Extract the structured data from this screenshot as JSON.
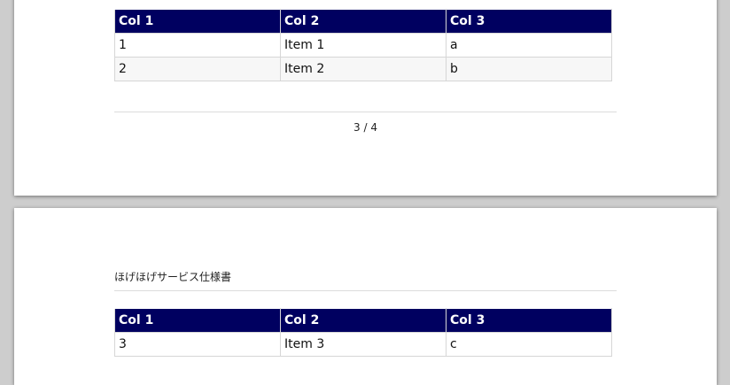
{
  "document": {
    "header_title": "ほげほげサービス仕様書"
  },
  "pages": [
    {
      "table": {
        "columns": [
          "Col 1",
          "Col 2",
          "Col 3"
        ],
        "rows": [
          [
            "1",
            "Item 1",
            "a"
          ],
          [
            "2",
            "Item 2",
            "b"
          ]
        ]
      },
      "page_number": "3 / 4"
    },
    {
      "table": {
        "columns": [
          "Col 1",
          "Col 2",
          "Col 3"
        ],
        "rows": [
          [
            "3",
            "Item 3",
            "c"
          ]
        ]
      }
    }
  ],
  "colors": {
    "background": "#cdcdcd",
    "page": "#ffffff",
    "table_header": "#000060",
    "table_header_text": "#ffffff",
    "row_alt": "#f7f7f7",
    "rule": "#dcdcdc"
  }
}
